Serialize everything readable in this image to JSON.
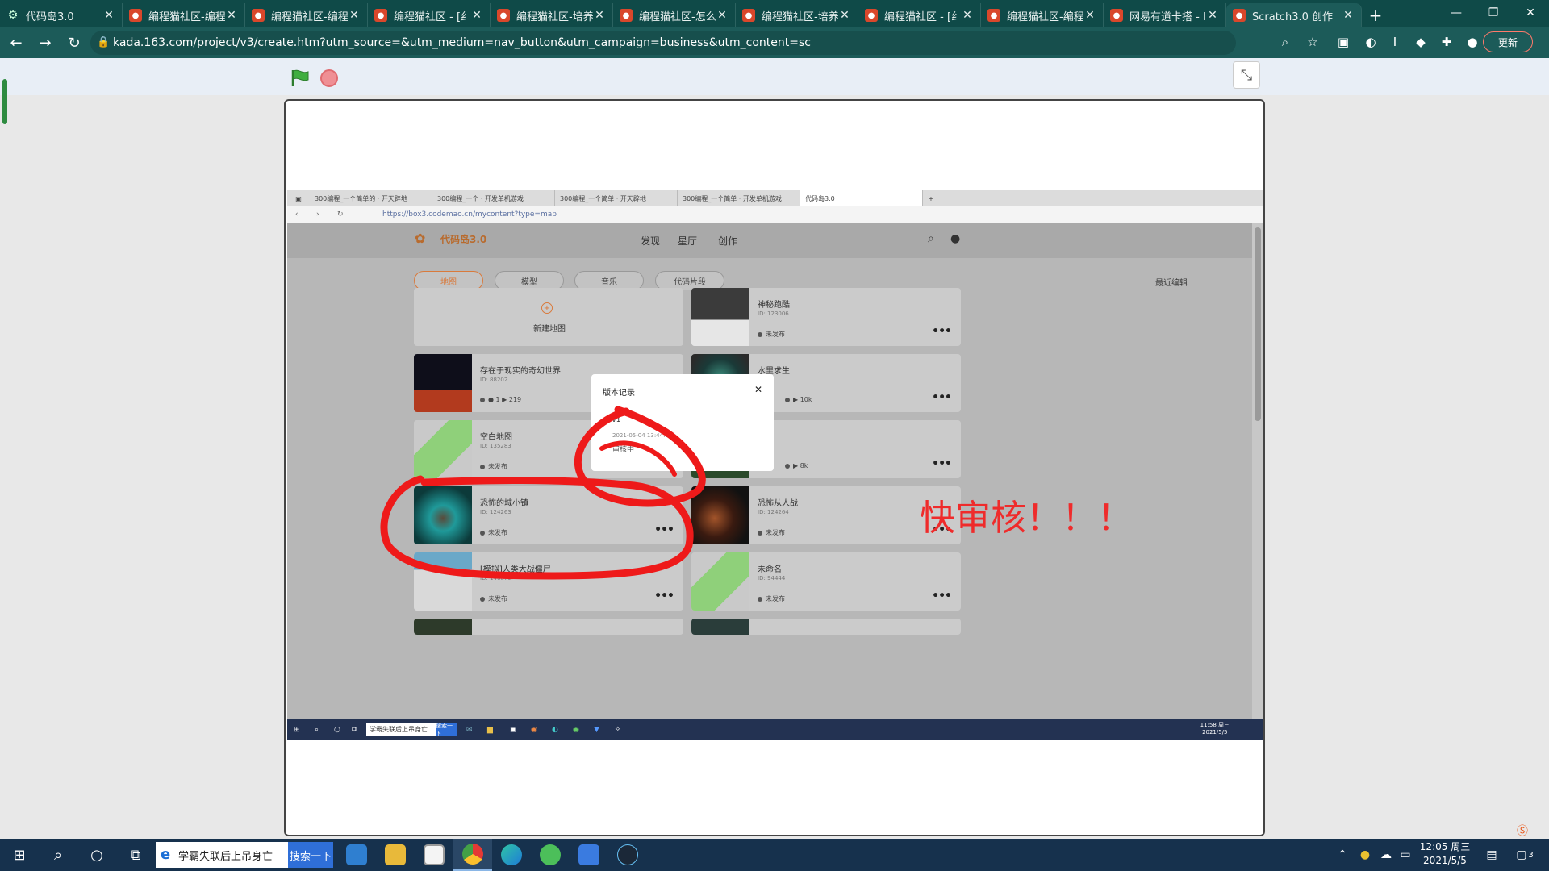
{
  "browser": {
    "tabs": [
      {
        "title": "代码岛3.0",
        "icon": "gear-icon"
      },
      {
        "title": "编程猫社区-编程",
        "icon": "codemao-icon"
      },
      {
        "title": "编程猫社区-编程",
        "icon": "codemao-icon"
      },
      {
        "title": "编程猫社区 - [纟",
        "icon": "codemao-icon"
      },
      {
        "title": "编程猫社区-培养",
        "icon": "codemao-icon"
      },
      {
        "title": "编程猫社区-怎么",
        "icon": "codemao-icon"
      },
      {
        "title": "编程猫社区-培养",
        "icon": "codemao-icon"
      },
      {
        "title": "编程猫社区 - [纟",
        "icon": "codemao-icon"
      },
      {
        "title": "编程猫社区-编程",
        "icon": "codemao-icon"
      },
      {
        "title": "网易有道卡搭 - I",
        "icon": "netease-icon"
      },
      {
        "title": "Scratch3.0 创作",
        "icon": "netease-icon"
      }
    ],
    "url": "kada.163.com/project/v3/create.htm?utm_source=&utm_medium=nav_button&utm_campaign=business&utm_content=sc",
    "update_label": "更新",
    "accent": "#0f4a48"
  },
  "inner": {
    "tabs": [
      "300编程_一个简单的 · 开天辟地",
      "300编程_一个 · 开发单机游戏",
      "300编程_一个简单 · 开天辟地",
      "300编程_一个简单 · 开发单机游戏",
      "代码岛3.0"
    ],
    "url": "https://box3.codemao.cn/mycontent?type=map",
    "logo": "代码岛3.0",
    "nav": [
      "发现",
      "星厅",
      "创作"
    ],
    "filters": [
      "地图",
      "模型",
      "音乐",
      "代码片段"
    ],
    "sort": "最近编辑",
    "new_map": "新建地图",
    "cards": [
      {
        "name": "神秘跑酷",
        "id": "ID: 123006",
        "status": "未发布",
        "stats": ""
      },
      {
        "name": "存在于现实的奇幻世界",
        "id": "ID: 88202",
        "status": "",
        "stats": "● 1   ▶ 219"
      },
      {
        "name": "水里求生",
        "id": "",
        "status": "",
        "stats": "▶ 10k"
      },
      {
        "name": "空白地图",
        "id": "ID: 135283",
        "status": "未发布",
        "stats": ""
      },
      {
        "name": "人战",
        "id": "",
        "status": "",
        "stats": "▶ 8k"
      },
      {
        "name": "恐怖的城小镇",
        "id": "ID: 124263",
        "status": "未发布",
        "stats": ""
      },
      {
        "name": "恐怖从人战",
        "id": "ID: 124264",
        "status": "未发布",
        "stats": ""
      },
      {
        "name": "[模拟]人类大战僵尸",
        "id": "ID: 146879",
        "status": "未发布",
        "stats": ""
      },
      {
        "name": "未命名",
        "id": "ID: 94444",
        "status": "未发布",
        "stats": ""
      }
    ],
    "dialog": {
      "title": "版本记录",
      "version": "v1",
      "date": "2021-05-04 13:44:30",
      "status": "审核中"
    },
    "taskbar_search": "学霸失联后上吊身亡",
    "taskbar_search_button": "搜索一下",
    "clock_time": "11:58 周三",
    "clock_date": "2021/5/5"
  },
  "annotation": "快审核！！！",
  "annotation_color": "#ef2b2b",
  "taskbar": {
    "search_text": "学霸失联后上吊身亡",
    "search_button": "搜索一下",
    "clock_time": "12:05 周三",
    "clock_date": "2021/5/5",
    "notify_count": "3"
  }
}
